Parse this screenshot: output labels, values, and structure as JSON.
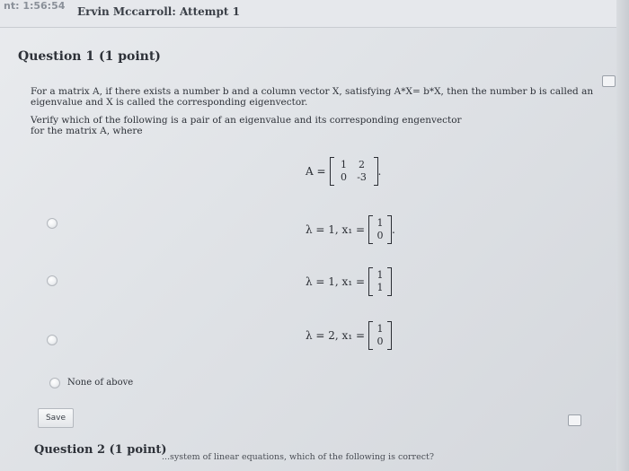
{
  "header": {
    "timer": "nt: 1:56:54",
    "attempt_title": "Ervin Mccarroll: Attempt 1"
  },
  "question1": {
    "title": "Question 1 (1 point)",
    "paragraph1": "For a matrix A, if there exists a number b and a column vector X, satisfying A*X= b*X, then the number b is called an eigenvalue and X is called the corresponding eigenvector.",
    "paragraph2": "Verify which of the following is a pair of an eigenvalue and its corresponding engenvector for the matrix A, where",
    "matrix_label": "A =",
    "matrix": [
      [
        "1",
        "2"
      ],
      [
        "0",
        "-3"
      ]
    ],
    "matrix_suffix": ".",
    "options": [
      {
        "lambda_text": "λ = 1, x₁ =",
        "vector": [
          "1",
          "0"
        ],
        "suffix": "."
      },
      {
        "lambda_text": "λ = 1, x₁ =",
        "vector": [
          "1",
          "1"
        ],
        "suffix": ""
      },
      {
        "lambda_text": "λ = 2, x₁ =",
        "vector": [
          "1",
          "0"
        ],
        "suffix": ""
      }
    ],
    "none_label": "None of above",
    "save_label": "Save"
  },
  "question2": {
    "title": "Question 2 (1 point)",
    "text_fragment": "...system of linear equations, which of the following is correct?"
  },
  "icons": {
    "flag": "flag-icon"
  }
}
